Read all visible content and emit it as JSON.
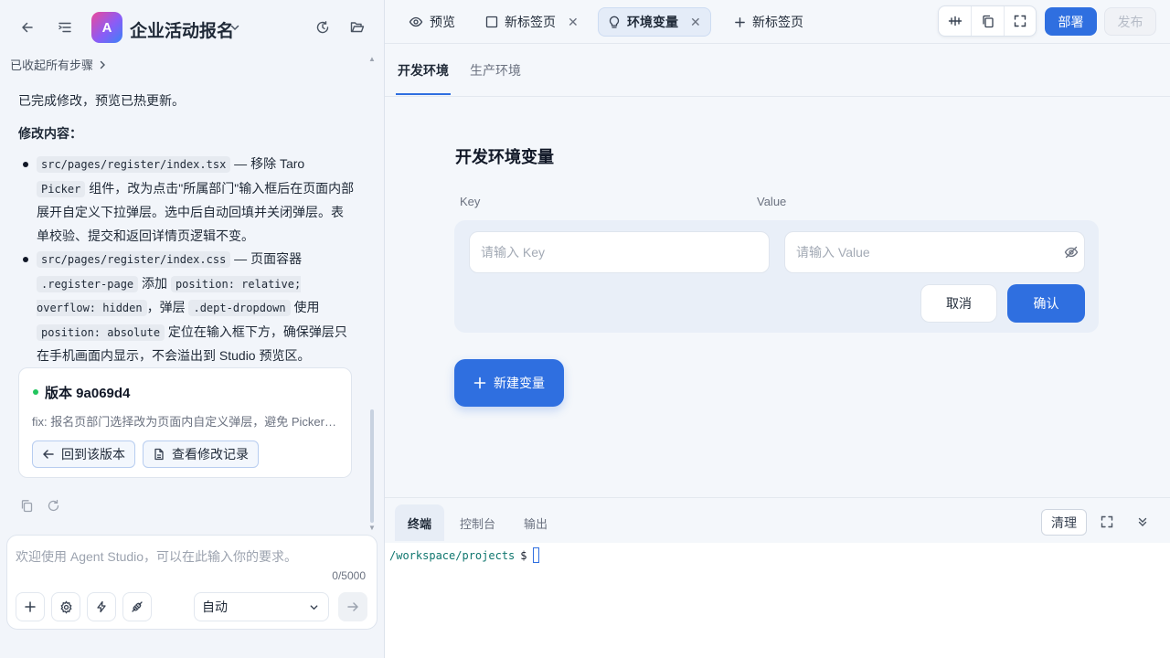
{
  "app": {
    "logo_letter": "A",
    "title": "企业活动报名"
  },
  "steps": {
    "toggle_label": "已收起所有步骤"
  },
  "chat": {
    "intro": "已完成修改，预览已热更新。",
    "changes_heading": "修改内容：",
    "item1": {
      "file": "src/pages/register/index.tsx",
      "text_a": " — 移除 Taro ",
      "code": "Picker",
      "text_b": " 组件，改为点击\"所属部门\"输入框后在页面内部展开自定义下拉弹层。选中后自动回填并关闭弹层。表单校验、提交和返回详情页逻辑不变。"
    },
    "item2": {
      "file": "src/pages/register/index.css",
      "text_a": " — 页面容器 ",
      "code1": ".register-page",
      "text_b": " 添加 ",
      "code2": "position: relative; overflow: hidden",
      "text_c": "，弹层 ",
      "code3": ".dept-dropdown",
      "text_d": " 使用 ",
      "code4": "position: absolute",
      "text_e": " 定位在输入框下方，确保弹层只在手机画面内显示，不会溢出到 Studio 预览区。"
    }
  },
  "version_card": {
    "title": "版本 9a069d4",
    "description": "fix: 报名页部门选择改为页面内自定义弹层，避免 Picker 弹出到预览区外",
    "revert_label": "回到该版本",
    "history_label": "查看修改记录"
  },
  "composer": {
    "placeholder": "欢迎使用 Agent Studio，可以在此输入你的要求。",
    "value": "",
    "char_count": "0/5000",
    "mode": "自动"
  },
  "tabs": [
    {
      "label": "预览"
    },
    {
      "label": "新标签页"
    },
    {
      "label": "环境变量"
    },
    {
      "label": "新标签页"
    }
  ],
  "toolbar": {
    "deploy_label": "部署",
    "publish_label": "发布"
  },
  "env_tabs": [
    {
      "label": "开发环境"
    },
    {
      "label": "生产环境"
    }
  ],
  "env_form": {
    "section_title": "开发环境变量",
    "key_label": "Key",
    "value_label": "Value",
    "key_placeholder": "请输入 Key",
    "value_placeholder": "请输入 Value",
    "cancel_label": "取消",
    "confirm_label": "确认",
    "new_var_label": "新建变量"
  },
  "bottom_panel": {
    "tabs": [
      {
        "label": "终端"
      },
      {
        "label": "控制台"
      },
      {
        "label": "输出"
      }
    ],
    "clear_label": "清理",
    "terminal_path": "/workspace/projects",
    "terminal_prompt": "$"
  },
  "colors": {
    "accent": "#2f6fe0",
    "status_green": "#22c55e",
    "terminal_path": "#0f766e"
  }
}
